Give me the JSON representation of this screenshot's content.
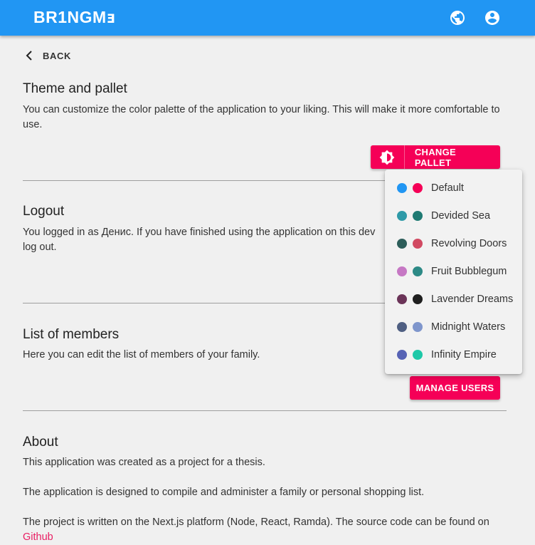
{
  "appbar": {
    "logo": "BR1NGMⱻ",
    "icons": [
      "globe-icon",
      "account-circle-icon"
    ]
  },
  "back": {
    "label": "BACK",
    "icon": "chevron-left-icon"
  },
  "theme": {
    "title": "Theme and pallet",
    "description": "You can customize the color palette of the application to your liking. This will make it more comfortable to use.",
    "button_label": "CHANGE PALLET",
    "button_icon": "brightness-icon"
  },
  "logout": {
    "title": "Logout",
    "description_line1": "You logged in as Денис. If you have finished using the application on this dev",
    "description_line2": "log out."
  },
  "members": {
    "title": "List of members",
    "description": "Here you can edit the list of members of your family.",
    "button_label": "MANAGE USERS"
  },
  "about": {
    "title": "About",
    "p1": "This application was created as a project for a thesis.",
    "p2": "The application is designed to compile and administer a family or personal shopping list.",
    "p3": "The project is written on the Next.js platform (Node, React, Ramda). The source code can be found on",
    "link": "Github"
  },
  "palette_menu": {
    "items": [
      {
        "label": "Default",
        "colors": [
          "#2196f3",
          "#f50057"
        ]
      },
      {
        "label": "Devided Sea",
        "colors": [
          "#2e9aa8",
          "#1f7a73"
        ]
      },
      {
        "label": "Revolving Doors",
        "colors": [
          "#2d5e5a",
          "#d14a62"
        ]
      },
      {
        "label": "Fruit Bubblegum",
        "colors": [
          "#c678c4",
          "#2d8a86"
        ]
      },
      {
        "label": "Lavender Dreams",
        "colors": [
          "#6b3458",
          "#1f1f1f"
        ]
      },
      {
        "label": "Midnight Waters",
        "colors": [
          "#4f5f82",
          "#7f96cc"
        ]
      },
      {
        "label": "Infinity Empire",
        "colors": [
          "#5763b5",
          "#1ec8a8"
        ]
      }
    ]
  },
  "colors": {
    "primary": "#2196f3",
    "accent": "#f50057",
    "background": "#f0f0f0"
  }
}
